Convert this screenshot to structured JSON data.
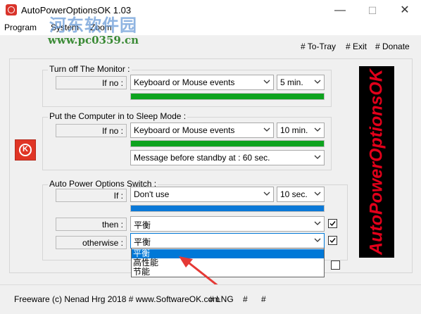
{
  "window": {
    "title": "AutoPowerOptionsOK 1.03",
    "minimize": "—",
    "maximize": "☐",
    "close": "✕"
  },
  "watermark": {
    "line1": "河东软件园",
    "line2": "www.pc0359.cn"
  },
  "menu": {
    "program": "Program",
    "system": "System",
    "zoom": "Zoom"
  },
  "toplinks": {
    "to_tray": "# To-Tray",
    "exit": "# Exit",
    "donate": "# Donate"
  },
  "monitor": {
    "title": "Turn off The Monitor :",
    "if_label": "If no :",
    "event": "Keyboard or Mouse events",
    "time": "5 min.",
    "progress": 1.0
  },
  "sleep": {
    "title": "Put the Computer in to Sleep Mode :",
    "if_label": "If no :",
    "event": "Keyboard or Mouse events",
    "time": "10 min.",
    "progress": 1.0,
    "message": "Message before standby at : 60 sec."
  },
  "switch": {
    "title": "Auto Power Options Switch :",
    "if_label": "If :",
    "condition": "Don't use",
    "time": "10 sec.",
    "progress": 1.0,
    "then_label": "then :",
    "then_value": "平衡",
    "otherwise_label": "otherwise :",
    "otherwise_value": "平衡",
    "dropdown_options": [
      "平衡",
      "高性能",
      "节能"
    ]
  },
  "brand": {
    "text": "AutoPowerOptionsOK"
  },
  "footer": {
    "copyright": "Freeware (c) Nenad Hrg 2018 # www.SoftwareOK.com",
    "lng": "# LNG",
    "hash1": "#",
    "hash2": "#"
  },
  "colors": {
    "progress_green": "#0da31e",
    "progress_blue": "#0a78d7",
    "dropdown_highlight": "#0078d7",
    "brand_red": "#e2001a",
    "arrow": "#e53935"
  }
}
